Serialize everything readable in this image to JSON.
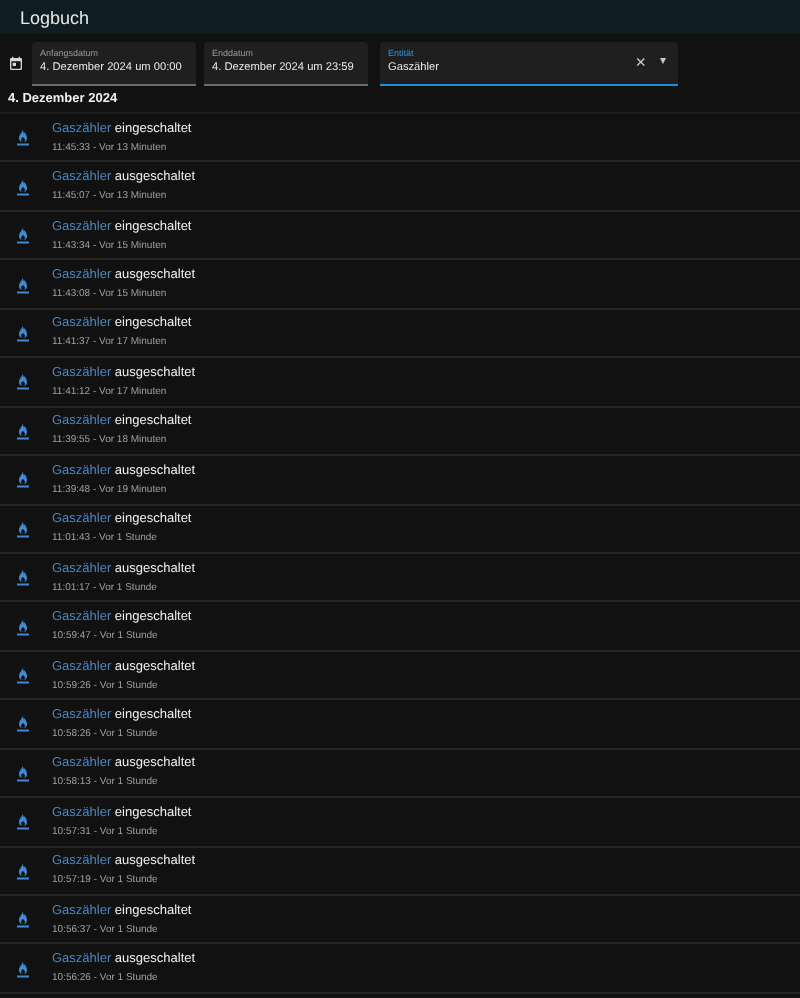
{
  "header": {
    "title": "Logbuch"
  },
  "filters": [
    {
      "label": "Anfangsdatum",
      "value": "4. Dezember 2024 um 00:00",
      "focused": false
    },
    {
      "label": "Enddatum",
      "value": "4. Dezember 2024 um 23:59",
      "focused": false
    },
    {
      "label": "Entität",
      "value": "Gaszähler",
      "focused": true,
      "clear": "×",
      "caret": "▾"
    }
  ],
  "date_heading": "4. Dezember 2024",
  "entries": [
    {
      "entity": "Gaszähler",
      "state": "eingeschaltet",
      "time": "11:45:33 - Vor 13 Minuten"
    },
    {
      "entity": "Gaszähler",
      "state": "ausgeschaltet",
      "time": "11:45:07 - Vor 13 Minuten"
    },
    {
      "entity": "Gaszähler",
      "state": "eingeschaltet",
      "time": "11:43:34 - Vor 15 Minuten"
    },
    {
      "entity": "Gaszähler",
      "state": "ausgeschaltet",
      "time": "11:43:08 - Vor 15 Minuten"
    },
    {
      "entity": "Gaszähler",
      "state": "eingeschaltet",
      "time": "11:41:37 - Vor 17 Minuten"
    },
    {
      "entity": "Gaszähler",
      "state": "ausgeschaltet",
      "time": "11:41:12 - Vor 17 Minuten"
    },
    {
      "entity": "Gaszähler",
      "state": "eingeschaltet",
      "time": "11:39:55 - Vor 18 Minuten"
    },
    {
      "entity": "Gaszähler",
      "state": "ausgeschaltet",
      "time": "11:39:48 - Vor 19 Minuten"
    },
    {
      "entity": "Gaszähler",
      "state": "eingeschaltet",
      "time": "11:01:43 - Vor 1 Stunde"
    },
    {
      "entity": "Gaszähler",
      "state": "ausgeschaltet",
      "time": "11:01:17 - Vor 1 Stunde"
    },
    {
      "entity": "Gaszähler",
      "state": "eingeschaltet",
      "time": "10:59:47 - Vor 1 Stunde"
    },
    {
      "entity": "Gaszähler",
      "state": "ausgeschaltet",
      "time": "10:59:26 - Vor 1 Stunde"
    },
    {
      "entity": "Gaszähler",
      "state": "eingeschaltet",
      "time": "10:58:26 - Vor 1 Stunde"
    },
    {
      "entity": "Gaszähler",
      "state": "ausgeschaltet",
      "time": "10:58:13 - Vor 1 Stunde"
    },
    {
      "entity": "Gaszähler",
      "state": "eingeschaltet",
      "time": "10:57:31 - Vor 1 Stunde"
    },
    {
      "entity": "Gaszähler",
      "state": "ausgeschaltet",
      "time": "10:57:19 - Vor 1 Stunde"
    },
    {
      "entity": "Gaszähler",
      "state": "eingeschaltet",
      "time": "10:56:37 - Vor 1 Stunde"
    },
    {
      "entity": "Gaszähler",
      "state": "ausgeschaltet",
      "time": "10:56:26 - Vor 1 Stunde"
    }
  ]
}
